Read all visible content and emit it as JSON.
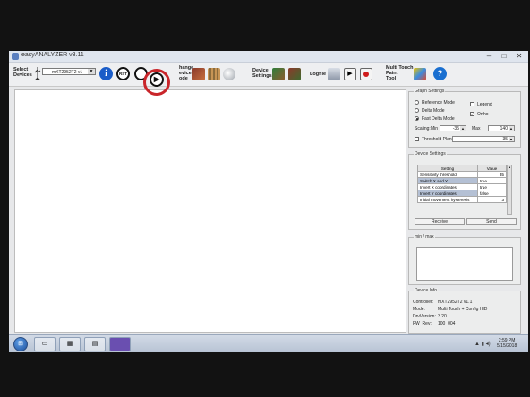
{
  "window": {
    "title": "easyANALYZER v3.11",
    "minimize": "–",
    "maximize": "□",
    "close": "✕"
  },
  "toolbar": {
    "select_devices_label": "Select\nDevices",
    "device_combo": "mXT2952T2 v1",
    "info_glyph": "i",
    "rst_glyph": "RST",
    "play_glyph": "▶",
    "change_mode_label": "hange\nevice\node",
    "device_settings_label": "Device\nSettings",
    "logfile_label": "Logfile",
    "multitouch_label": "Multi Touch\nPaint\nTool",
    "help_glyph": "?"
  },
  "graph_settings": {
    "title": "Graph Settings",
    "modes": [
      {
        "label": "Reference Mode",
        "selected": false
      },
      {
        "label": "Delta Mode",
        "selected": false
      },
      {
        "label": "Fast Delta Mode",
        "selected": true
      }
    ],
    "legend_label": "Legend",
    "legend_checked": false,
    "ortho_label": "Ortho",
    "ortho_checked": true,
    "scaling_label": "Scaling:",
    "min_label": "Min",
    "min_value": "-35",
    "max_label": "Max",
    "max_value": "140",
    "threshold_label": "Threshold Plane",
    "threshold_checked": false,
    "threshold_value": "35"
  },
  "device_settings": {
    "title": "Device Settings",
    "col_setting": "Setting",
    "col_value": "Value",
    "rows": [
      {
        "name": "Sensitivity threshold",
        "value": "35"
      },
      {
        "name": "Switch X and Y",
        "value": "true"
      },
      {
        "name": "Invert X coordinates",
        "value": "true"
      },
      {
        "name": "Invert Y coordinates",
        "value": "false"
      },
      {
        "name": "Initial movement hysteresis",
        "value": "3"
      }
    ],
    "receive_label": "Receive",
    "send_label": "Send"
  },
  "minmax": {
    "title": "min / max"
  },
  "device_info": {
    "title": "Device Info",
    "controller_label": "Controller:",
    "controller_value": "mXT2952T2 v1.1",
    "mode_label": "Mode:",
    "mode_value": "Multi Touch + Config HID",
    "driver_label": "DrvVersion:",
    "driver_value": "3.20",
    "fw_label": "FW_Rev:",
    "fw_value": "100_004"
  },
  "taskbar": {
    "time": "2:59 PM",
    "date": "5/15/2018"
  },
  "colors": {
    "highlight_ring": "#c9252a",
    "info_blue": "#1a5cc8",
    "help_blue": "#1a6fd0"
  }
}
